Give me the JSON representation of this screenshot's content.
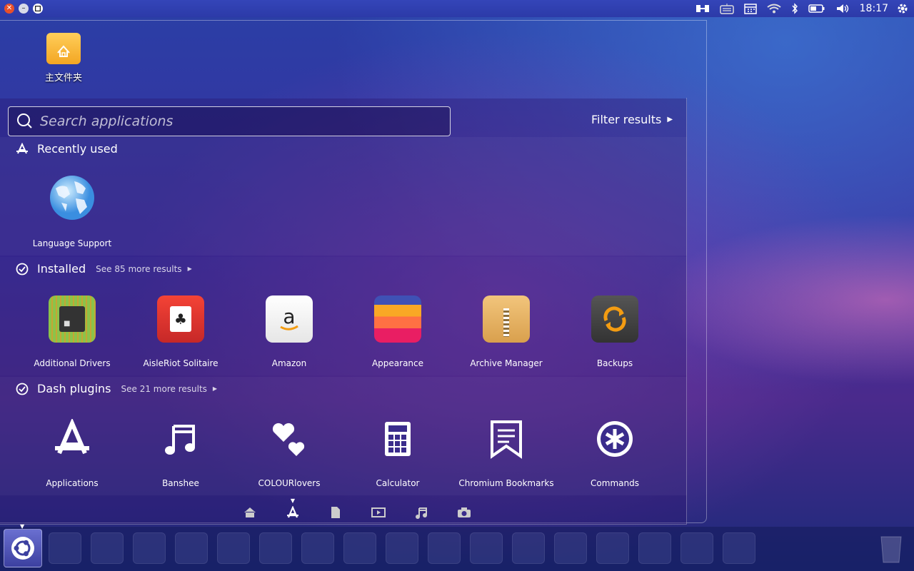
{
  "topbar": {
    "clock": "18:17",
    "indicators": [
      "switch-icon",
      "keyboard-icon",
      "calendar-icon",
      "wifi-icon",
      "bluetooth-icon",
      "battery-icon",
      "volume-icon",
      "gear-icon"
    ]
  },
  "desktop": {
    "home_folder_label": "主文件夹"
  },
  "dash": {
    "search_placeholder": "Search applications",
    "filter_label": "Filter results",
    "sections": {
      "recent": {
        "title": "Recently used",
        "items": [
          "Language Support"
        ]
      },
      "installed": {
        "title": "Installed",
        "more": "See 85 more results",
        "items": [
          "Additional Drivers",
          "AisleRiot Solitaire",
          "Amazon",
          "Appearance",
          "Archive Manager",
          "Backups"
        ]
      },
      "plugins": {
        "title": "Dash plugins",
        "more": "See 21 more results",
        "items": [
          "Applications",
          "Banshee",
          "COLOURlovers",
          "Calculator",
          "Chromium Bookmarks",
          "Commands"
        ]
      }
    },
    "lenses": [
      "home-lens-icon",
      "applications-lens-icon",
      "files-lens-icon",
      "video-lens-icon",
      "music-lens-icon",
      "photo-lens-icon"
    ]
  },
  "colors": {
    "accent": "#e8502b",
    "folder": "#f3a623"
  }
}
